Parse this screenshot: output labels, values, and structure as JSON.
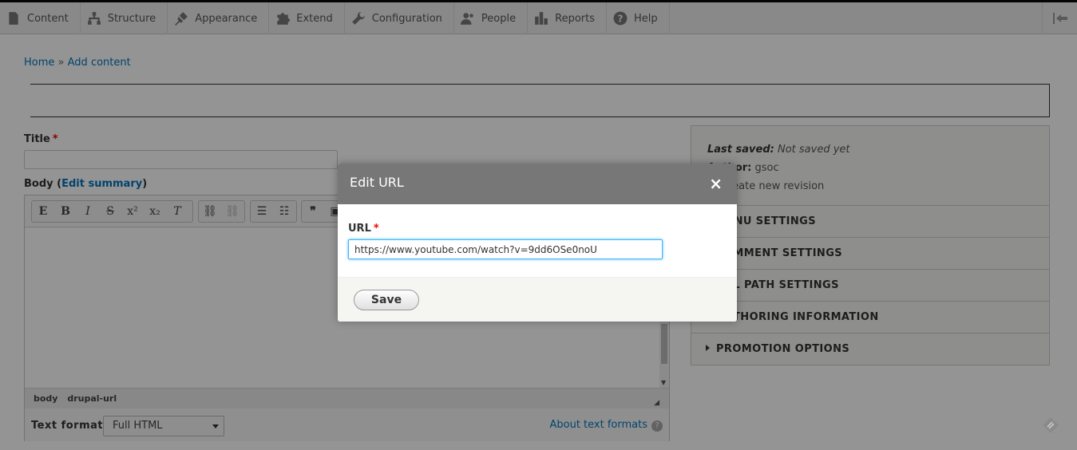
{
  "toolbar": {
    "items": [
      {
        "label": "Content",
        "icon": "file-icon"
      },
      {
        "label": "Structure",
        "icon": "sitemap-icon"
      },
      {
        "label": "Appearance",
        "icon": "paintbrush-icon"
      },
      {
        "label": "Extend",
        "icon": "puzzle-icon"
      },
      {
        "label": "Configuration",
        "icon": "wrench-icon"
      },
      {
        "label": "People",
        "icon": "people-icon"
      },
      {
        "label": "Reports",
        "icon": "bar-chart-icon"
      },
      {
        "label": "Help",
        "icon": "help-icon"
      }
    ]
  },
  "breadcrumb": {
    "home": "Home",
    "separator": "»",
    "current": "Add content"
  },
  "form": {
    "title_label": "Title",
    "body_label": "Body",
    "edit_summary": "Edit summary",
    "required_mark": "*"
  },
  "editor": {
    "path": [
      "body",
      "drupal-url"
    ],
    "text_format_label": "Text format",
    "text_format_value": "Full HTML",
    "about_formats": "About text formats",
    "help_glyph": "?"
  },
  "sidebar": {
    "last_saved_label": "Last saved:",
    "last_saved_value": "Not saved yet",
    "author_label": "Author:",
    "author_value": "gsoc",
    "revision_label": "Create new revision",
    "sections": [
      "MENU SETTINGS",
      "COMMENT SETTINGS",
      "URL PATH SETTINGS",
      "AUTHORING INFORMATION",
      "PROMOTION OPTIONS"
    ]
  },
  "dialog": {
    "title": "Edit URL",
    "close_glyph": "×",
    "url_label": "URL",
    "url_value": "https://www.youtube.com/watch?v=9dd6OSe0noU",
    "save_label": "Save"
  },
  "colors": {
    "link": "#0074bd",
    "required": "#e00000",
    "focus": "#40b6ff"
  }
}
